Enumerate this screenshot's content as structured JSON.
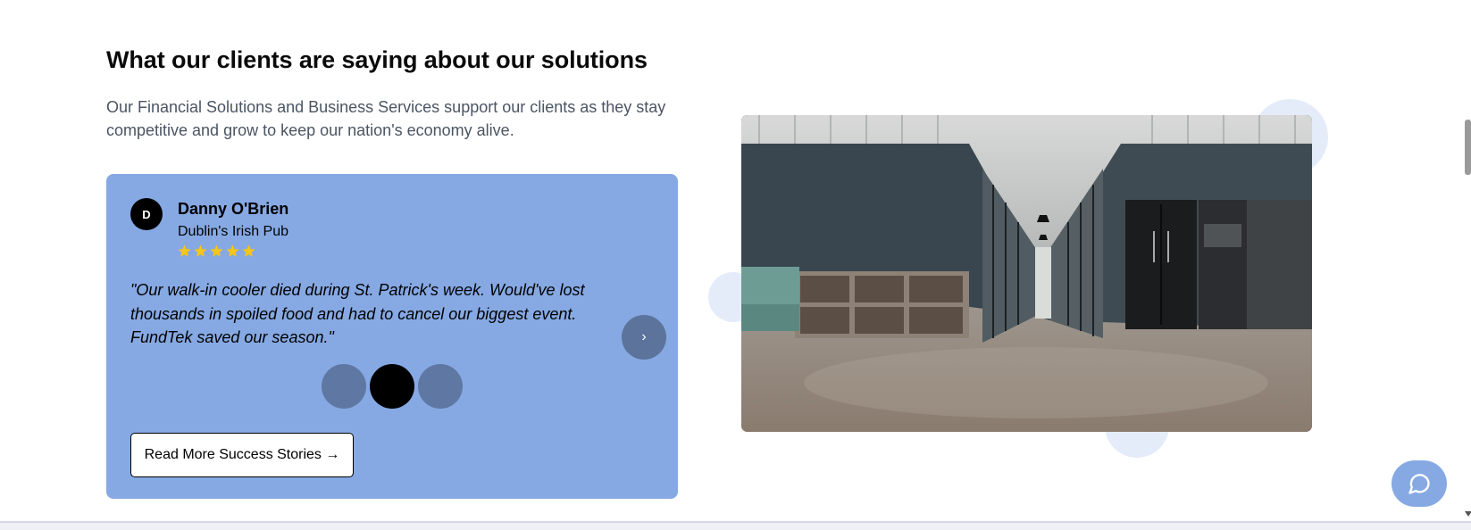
{
  "section": {
    "title": "What our clients are saying about our solutions",
    "subtitle": "Our Financial Solutions and Business Services support our clients as they stay competitive and grow to keep our nation's economy alive."
  },
  "testimonial": {
    "avatar_initial": "D",
    "name": "Danny O'Brien",
    "business": "Dublin's Irish Pub",
    "rating": 5,
    "rating_max": 5,
    "quote": "\"Our walk-in cooler died during St. Patrick's week. Would've lost thousands in spoiled food and had to cancel our biggest event. FundTek saved our season.\"",
    "next_icon": "›",
    "slides_count": 3,
    "active_slide": 2
  },
  "cta": {
    "read_more_label": "Read More Success Stories →"
  },
  "colors": {
    "card_bg": "#86a9e3",
    "star": "#f5c518",
    "accent": "#86a9e3",
    "heading": "#0a0a0a",
    "subtext": "#4b5563"
  },
  "icons": {
    "star": "star-icon",
    "chat": "chat-bubble-icon",
    "next": "chevron-right-icon"
  }
}
